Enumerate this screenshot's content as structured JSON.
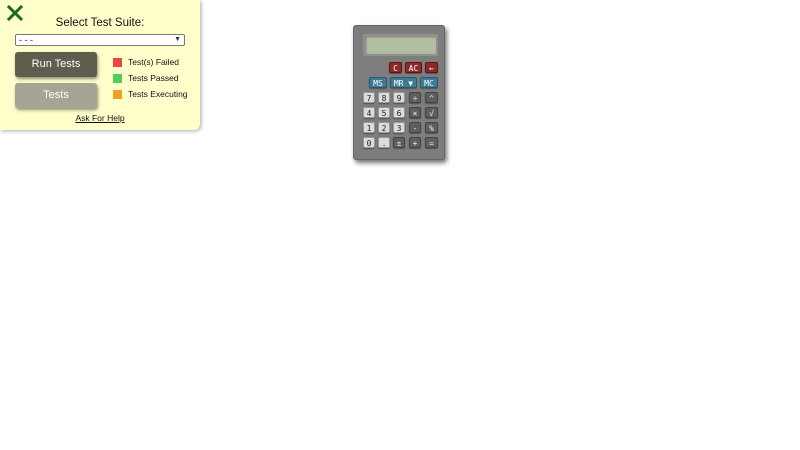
{
  "panel": {
    "title": "Select Test Suite:",
    "suite_select": {
      "selected": "- - -"
    },
    "run_tests_label": "Run Tests",
    "tests_label": "Tests",
    "legend": [
      {
        "label": "Test(s) Failed",
        "color": "#ee4444"
      },
      {
        "label": "Tests Passed",
        "color": "#55cc55"
      },
      {
        "label": "Tests Executing",
        "color": "#f0a020"
      }
    ],
    "help_link": "Ask For Help"
  },
  "calculator": {
    "display": "",
    "keys": {
      "clear": "C",
      "all_clear": "AC",
      "backspace": "←",
      "ms": "MS",
      "mr": "MR ▼",
      "mc": "MC",
      "seven": "7",
      "eight": "8",
      "nine": "9",
      "divide": "÷",
      "power": "^",
      "four": "4",
      "five": "5",
      "six": "6",
      "multiply": "×",
      "sqrt": "√",
      "one": "1",
      "two": "2",
      "three": "3",
      "minus": "-",
      "percent": "%",
      "zero": "0",
      "point": ".",
      "plus_minus": "±",
      "plus": "+",
      "equals": "="
    }
  }
}
